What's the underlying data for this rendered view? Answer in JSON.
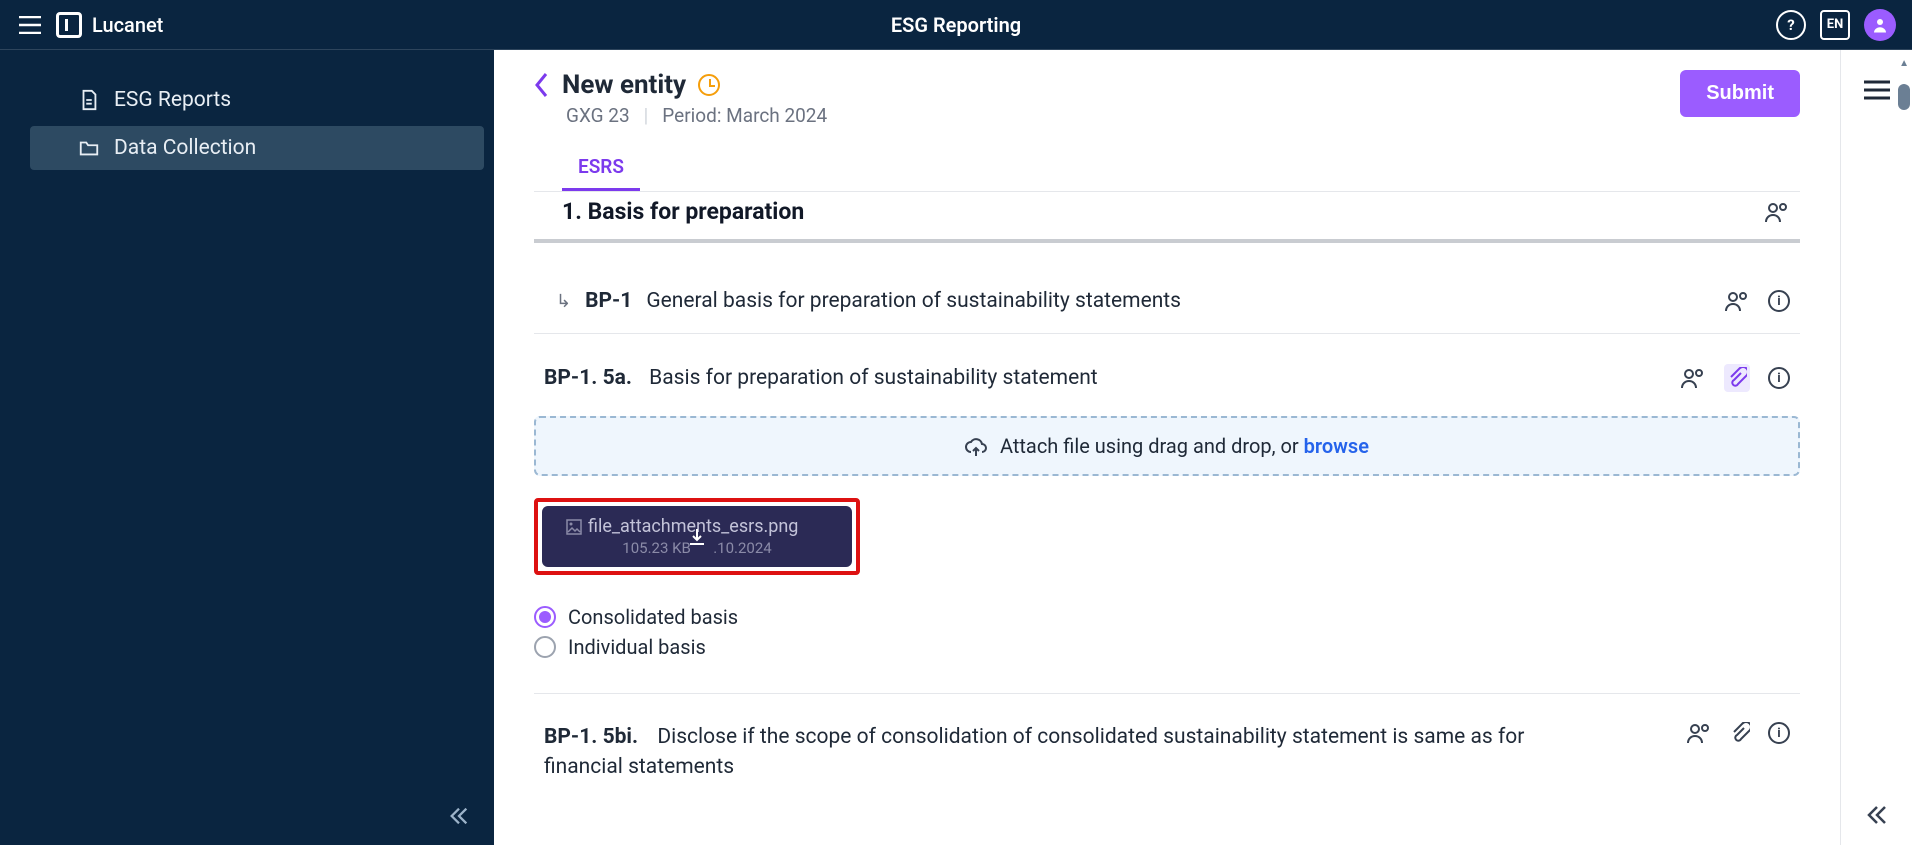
{
  "header": {
    "brand": "Lucanet",
    "appTitle": "ESG Reporting",
    "lang": "EN"
  },
  "sidebar": {
    "items": [
      {
        "label": "ESG Reports"
      },
      {
        "label": "Data Collection"
      }
    ]
  },
  "page": {
    "title": "New entity",
    "code": "GXG 23",
    "periodLabel": "Period: March 2024",
    "submit": "Submit",
    "tabs": [
      {
        "label": "ESRS"
      }
    ],
    "section": {
      "title": "1. Basis for preparation"
    },
    "bpHeader": {
      "code": "BP-1",
      "title": "General basis for preparation of sustainability statements"
    },
    "q1": {
      "code": "BP-1. 5a.",
      "text": "Basis for preparation of sustainability statement",
      "attachPrompt": "Attach file using drag and drop, or ",
      "browse": "browse",
      "file": {
        "name": "file_attachments_esrs.png",
        "size": "105.23 KB",
        "date": ".10.2024"
      },
      "radios": [
        {
          "label": "Consolidated basis",
          "selected": true
        },
        {
          "label": "Individual basis",
          "selected": false
        }
      ]
    },
    "q2": {
      "code": "BP-1. 5bi.",
      "text": "Disclose if the scope of consolidation of consolidated sustainability statement is same as for financial statements"
    }
  }
}
